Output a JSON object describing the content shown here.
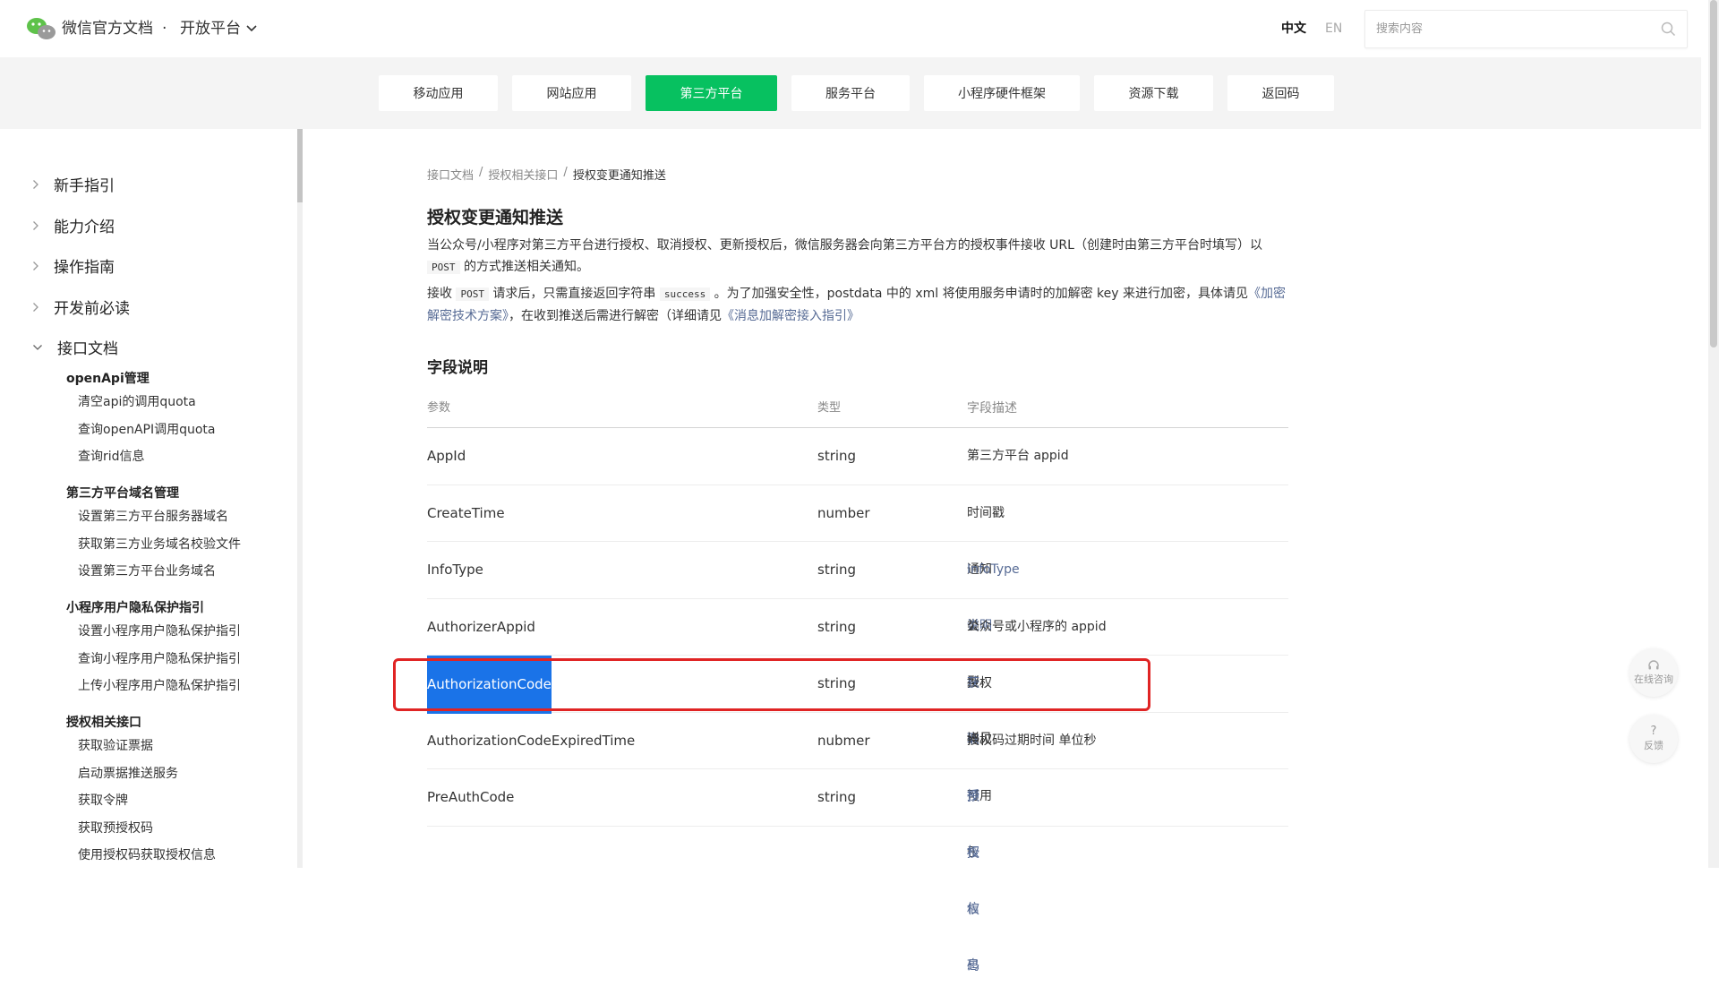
{
  "header": {
    "brand": "微信官方文档",
    "dot": "·",
    "platform": "开放平台",
    "lang_zh": "中文",
    "lang_en": "EN",
    "search_placeholder": "搜索内容"
  },
  "nav_tabs": [
    {
      "label": "移动应用",
      "active": false
    },
    {
      "label": "网站应用",
      "active": false
    },
    {
      "label": "第三方平台",
      "active": true
    },
    {
      "label": "服务平台",
      "active": false
    },
    {
      "label": "小程序硬件框架",
      "active": false
    },
    {
      "label": "资源下载",
      "active": false
    },
    {
      "label": "返回码",
      "active": false
    }
  ],
  "sidebar": {
    "top_items": [
      {
        "label": "新手指引"
      },
      {
        "label": "能力介绍"
      },
      {
        "label": "操作指南"
      },
      {
        "label": "开发前必读"
      },
      {
        "label": "接口文档"
      }
    ],
    "sections": [
      {
        "title": "openApi管理",
        "items": [
          "清空api的调用quota",
          "查询openAPI调用quota",
          "查询rid信息"
        ]
      },
      {
        "title": "第三方平台域名管理",
        "items": [
          "设置第三方平台服务器域名",
          "获取第三方业务域名校验文件",
          "设置第三方平台业务域名"
        ]
      },
      {
        "title": "小程序用户隐私保护指引",
        "items": [
          "设置小程序用户隐私保护指引",
          "查询小程序用户隐私保护指引",
          "上传小程序用户隐私保护指引"
        ]
      },
      {
        "title": "授权相关接口",
        "items": [
          "获取验证票据",
          "启动票据推送服务",
          "获取令牌",
          "获取预授权码",
          "使用授权码获取授权信息"
        ]
      }
    ]
  },
  "breadcrumb": {
    "items": [
      "接口文档",
      "授权相关接口",
      "授权变更通知推送"
    ],
    "sep": "/"
  },
  "content": {
    "title": "授权变更通知推送",
    "p1_a": "当公众号/小程序对第三方平台进行授权、取消授权、更新授权后，微信服务器会向第三方平台方的授权事件接收 URL（创建时由第三方平台时填写）以",
    "p1_code": "POST",
    "p1_b": "的方式推送相关通知。",
    "p2_a": "接收",
    "p2_code1": "POST",
    "p2_b": "请求后，只需直接返回字符串",
    "p2_code2": "success",
    "p2_c": "。为了加强安全性，postdata 中的 xml 将使用服务申请时的加解密 key 来进行加密，具体请见",
    "p2_link1": "《加密解密技术方案》",
    "p2_d": "，在收到推送后需进行解密（详细请见",
    "p2_link2": "《消息加解密接入指引》",
    "section_title": "字段说明"
  },
  "table": {
    "headers": [
      "参数",
      "类型",
      "字段描述"
    ],
    "rows": [
      {
        "param": "AppId",
        "type": "string",
        "desc": "第三方平台 appid",
        "link": ""
      },
      {
        "param": "CreateTime",
        "type": "number",
        "desc": "时间戳",
        "link": ""
      },
      {
        "param": "InfoType",
        "type": "string",
        "desc": "通知类型，详见",
        "link": "InfoType 说明"
      },
      {
        "param": "AuthorizerAppid",
        "type": "string",
        "desc": "公众号或小程序的 appid",
        "link": ""
      },
      {
        "param": "AuthorizationCode",
        "type": "string",
        "desc": "授权码，可用于",
        "link": "获取授权信息"
      },
      {
        "param": "AuthorizationCodeExpiredTime",
        "type": "nubmer",
        "desc": "授权码过期时间 单位秒",
        "link": ""
      },
      {
        "param": "PreAuthCode",
        "type": "string",
        "desc": "",
        "link": "预授权码"
      }
    ]
  },
  "float_buttons": [
    {
      "icon": "headset-icon",
      "label": "在线咨询"
    },
    {
      "icon": "question-icon",
      "label": "反馈"
    }
  ],
  "colors": {
    "accent": "#07c160",
    "link": "#576b95",
    "selection": "#1a73e8",
    "annotation": "#e02424"
  }
}
